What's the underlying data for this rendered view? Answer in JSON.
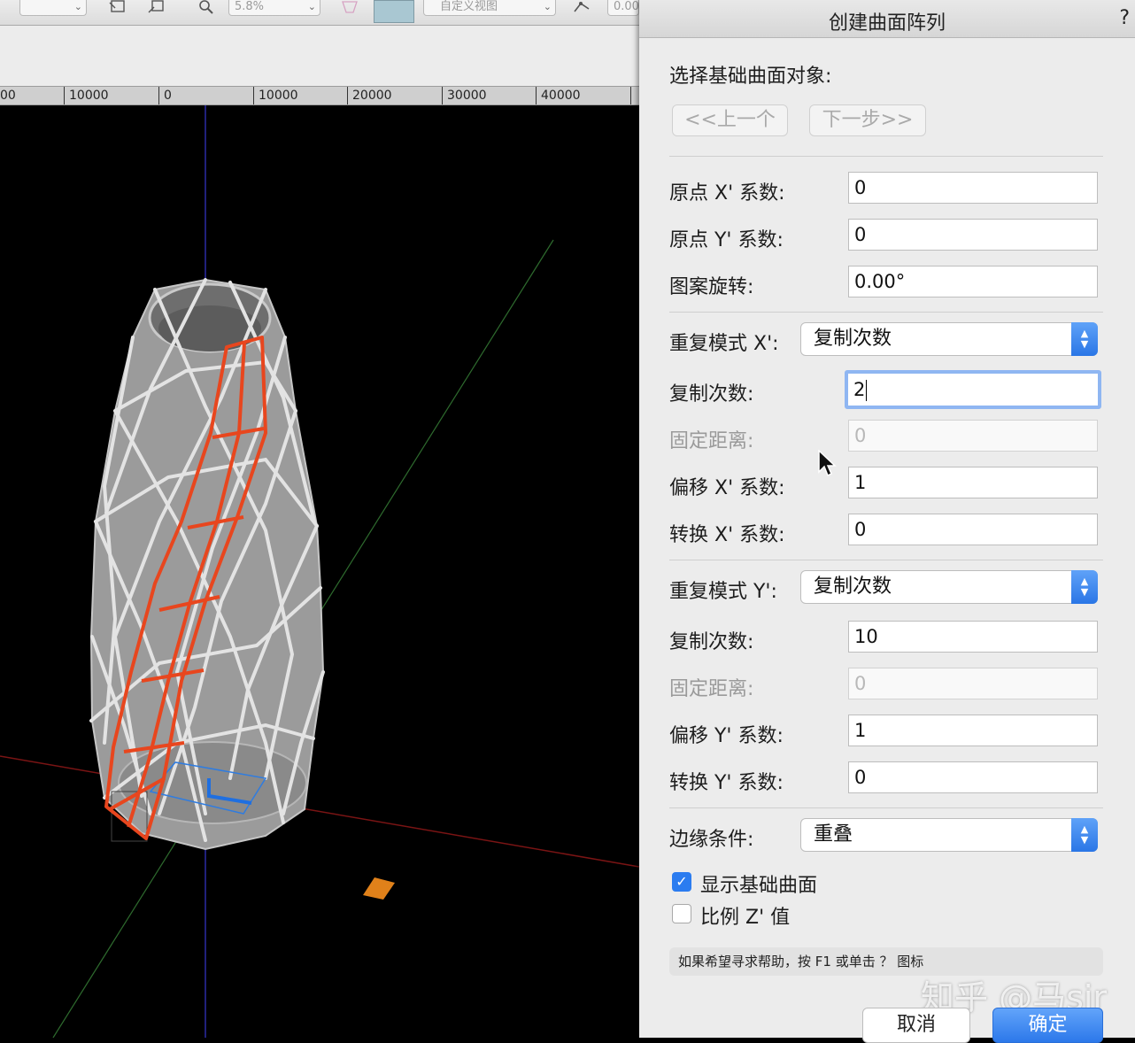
{
  "toolbar": {
    "zoom_value": "5.8%",
    "view_select": "自定义视图",
    "coord_value": "0.00"
  },
  "ruler": {
    "labels": [
      "00",
      "10000",
      "0",
      "10000",
      "20000",
      "30000",
      "40000"
    ]
  },
  "dialog": {
    "title": "创建曲面阵列",
    "help_mark": "?",
    "select_base_label": "选择基础曲面对象:",
    "prev_button": "<<上一个",
    "next_button": "下一步>>",
    "origin_x_label": "原点 X' 系数:",
    "origin_x_value": "0",
    "origin_y_label": "原点 Y' 系数:",
    "origin_y_value": "0",
    "rotation_label": "图案旋转:",
    "rotation_value": "0.00°",
    "repeat_x_label": "重复模式 X':",
    "repeat_x_value": "复制次数",
    "count_x_label": "复制次数:",
    "count_x_value": "2",
    "fixed_x_label": "固定距离:",
    "fixed_x_value": "0",
    "offset_x_label": "偏移 X' 系数:",
    "offset_x_value": "1",
    "transform_x_label": "转换 X' 系数:",
    "transform_x_value": "0",
    "repeat_y_label": "重复模式 Y':",
    "repeat_y_value": "复制次数",
    "count_y_label": "复制次数:",
    "count_y_value": "10",
    "fixed_y_label": "固定距离:",
    "fixed_y_value": "0",
    "offset_y_label": "偏移 Y' 系数:",
    "offset_y_value": "1",
    "transform_y_label": "转换 Y' 系数:",
    "transform_y_value": "0",
    "edge_label": "边缘条件:",
    "edge_value": "重叠",
    "show_base_label": "显示基础曲面",
    "show_base_checked": true,
    "scale_z_label": "比例 Z' 值",
    "scale_z_checked": false,
    "hint": "如果希望寻求帮助，按 F1 或单击 ？ 图标",
    "cancel_button": "取消",
    "ok_button": "确定",
    "watermark": "知乎 @马sir"
  },
  "colors": {
    "accent": "#2b7cf0",
    "highlight_orange": "#e8461e",
    "background": "#000000"
  }
}
